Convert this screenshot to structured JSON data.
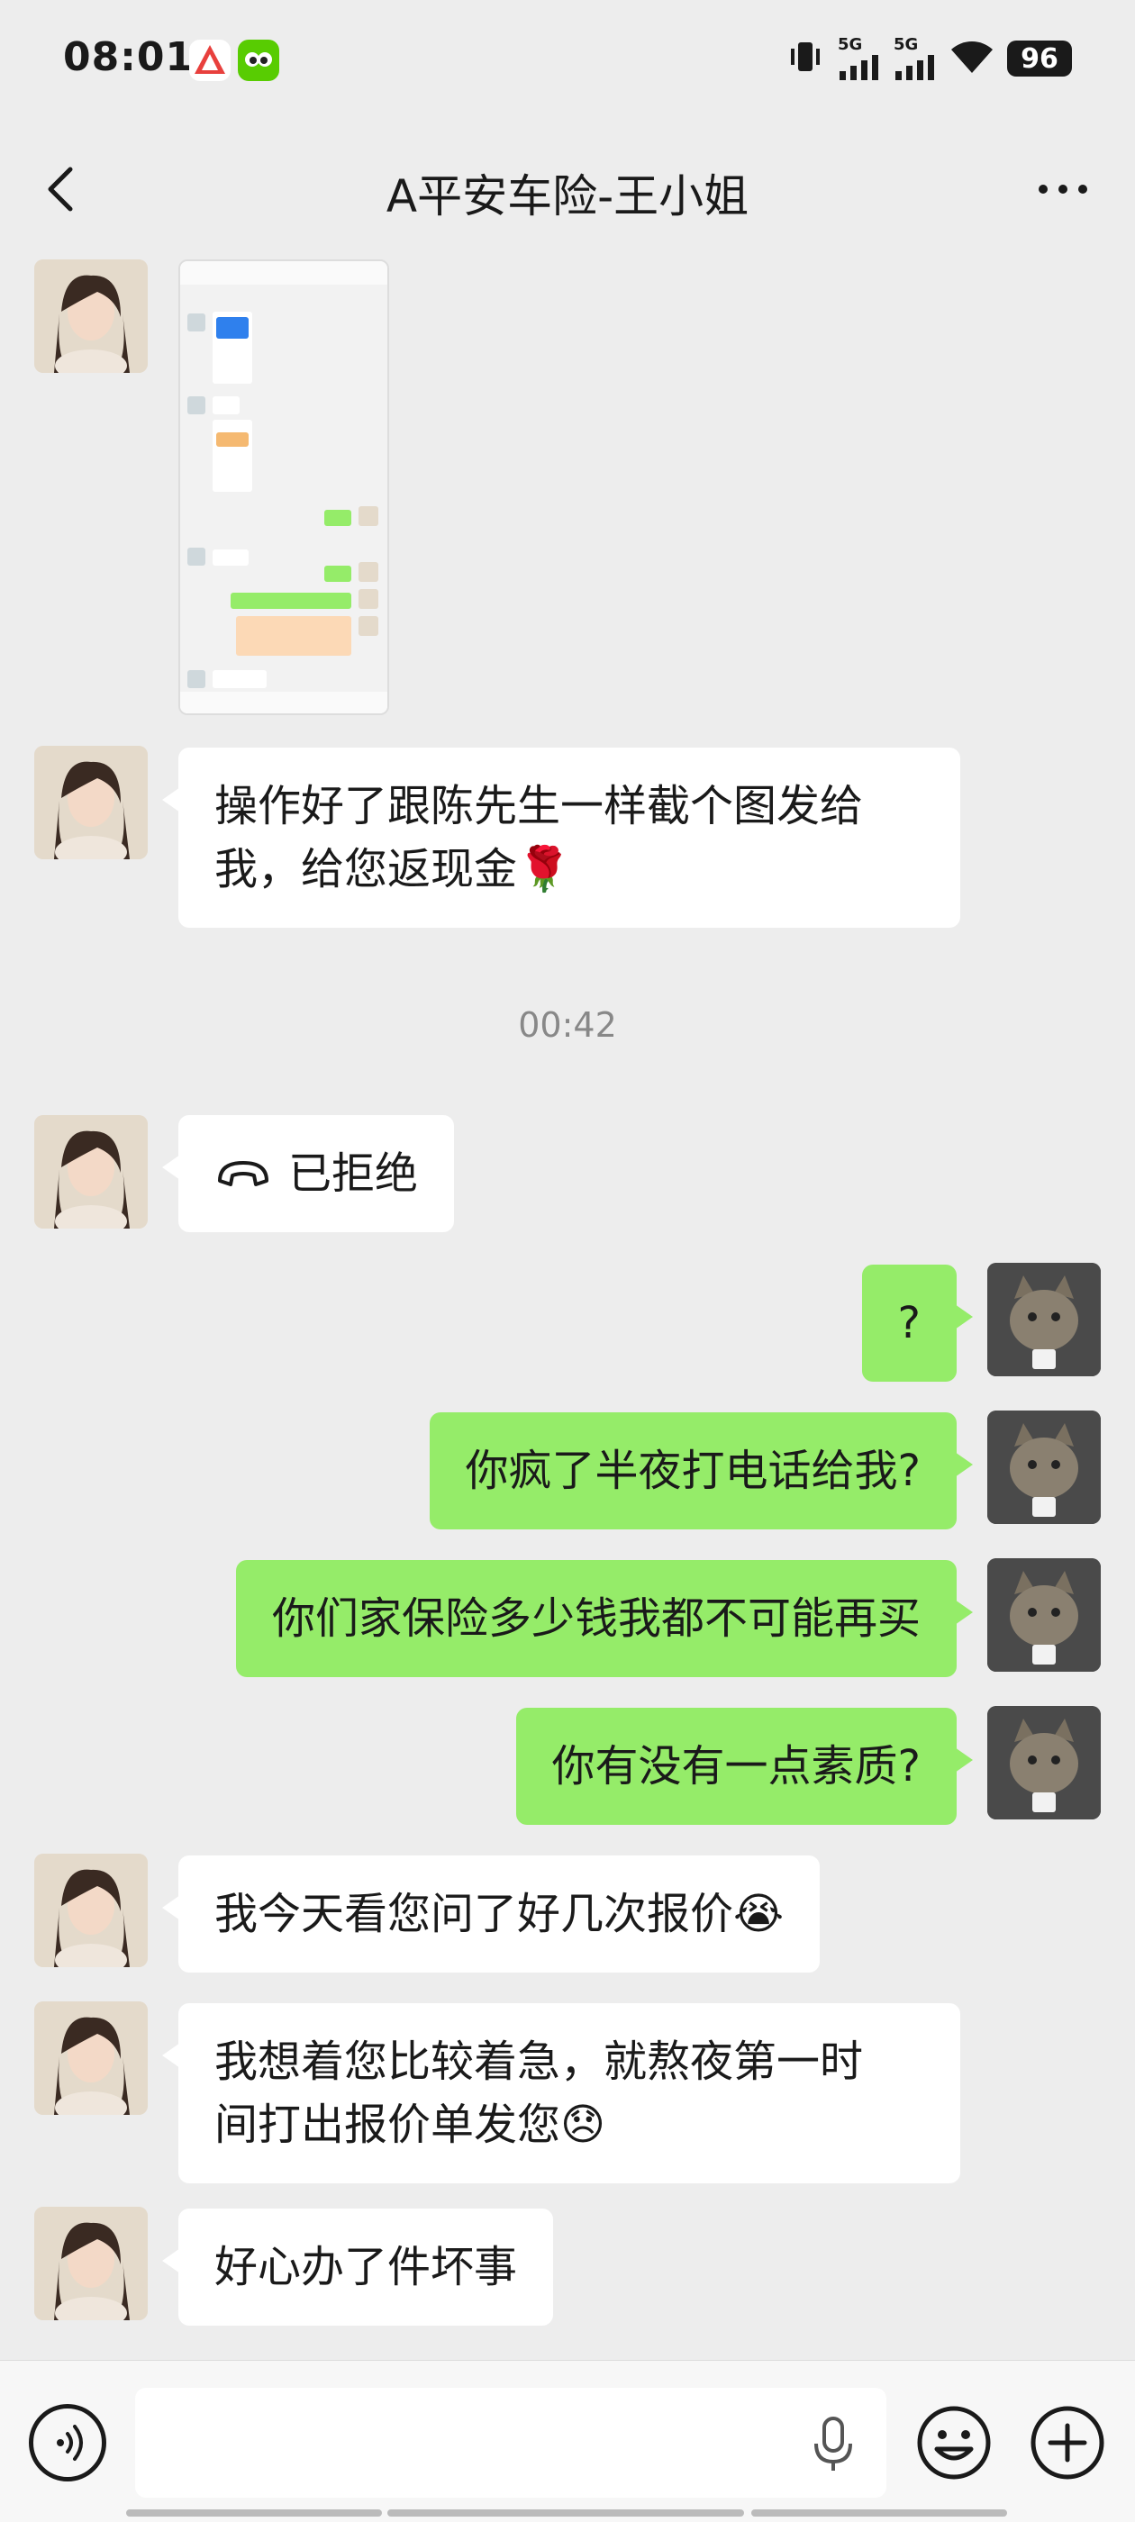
{
  "status_bar": {
    "time": "08:01",
    "network_1": "5G",
    "network_2": "5G",
    "battery": "96"
  },
  "header": {
    "title": "A平安车险-王小姐"
  },
  "messages": {
    "m1_text": "操作好了跟陈先生一样截个图发给",
    "m1_text2": "我，给您返现金🌹",
    "timestamp": "00:42",
    "call_label": "已拒绝",
    "o1": "?",
    "o2": "你疯了半夜打电话给我?",
    "o3": "你们家保险多少钱我都不可能再买",
    "o4": "你有没有一点素质?",
    "m2": "我今天看您问了好几次报价😭",
    "m3_line1": "我想着您比较着急，就熬夜第一时",
    "m3_line2": "间打出报价单发您😞",
    "m4": "好心办了件坏事"
  },
  "colors": {
    "background": "#ededed",
    "incoming_bubble": "#ffffff",
    "outgoing_bubble": "#95ec69"
  }
}
